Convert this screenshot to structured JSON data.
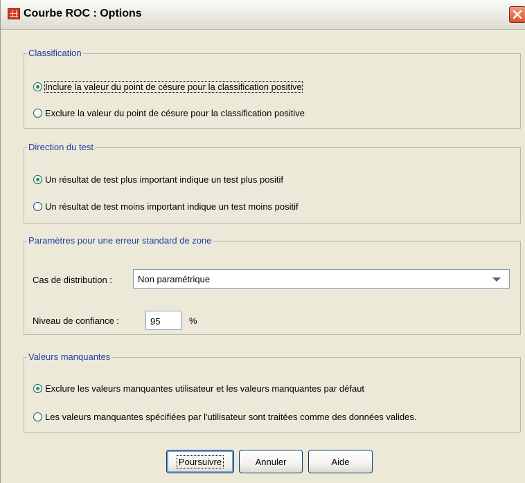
{
  "window": {
    "title": "Courbe ROC : Options",
    "close_label": "close"
  },
  "classification": {
    "legend": "Classification",
    "options": [
      {
        "label": "Inclure la valeur du point de césure pour la classification positive",
        "selected": true
      },
      {
        "label": "Exclure la valeur du point de césure pour la classification positive",
        "selected": false
      }
    ]
  },
  "direction": {
    "legend": "Direction du test",
    "options": [
      {
        "label": "Un résultat de test plus important indique un test plus positif",
        "selected": true
      },
      {
        "label": "Un résultat de test moins important indique un test moins positif",
        "selected": false
      }
    ]
  },
  "parametres": {
    "legend": "Paramètres pour une erreur standard de zone",
    "distribution_label": "Cas de distribution :",
    "distribution_value": "Non paramétrique",
    "confiance_label": "Niveau de confiance :",
    "confiance_value": "95",
    "confiance_unit": "%"
  },
  "manquantes": {
    "legend": "Valeurs manquantes",
    "options": [
      {
        "label": "Exclure les valeurs manquantes utilisateur et les valeurs manquantes par défaut",
        "selected": true
      },
      {
        "label": "Les valeurs manquantes spécifiées par l'utilisateur sont traitées comme des données valides.",
        "selected": false
      }
    ]
  },
  "buttons": {
    "continue": "Poursuivre",
    "cancel": "Annuler",
    "help": "Aide"
  }
}
